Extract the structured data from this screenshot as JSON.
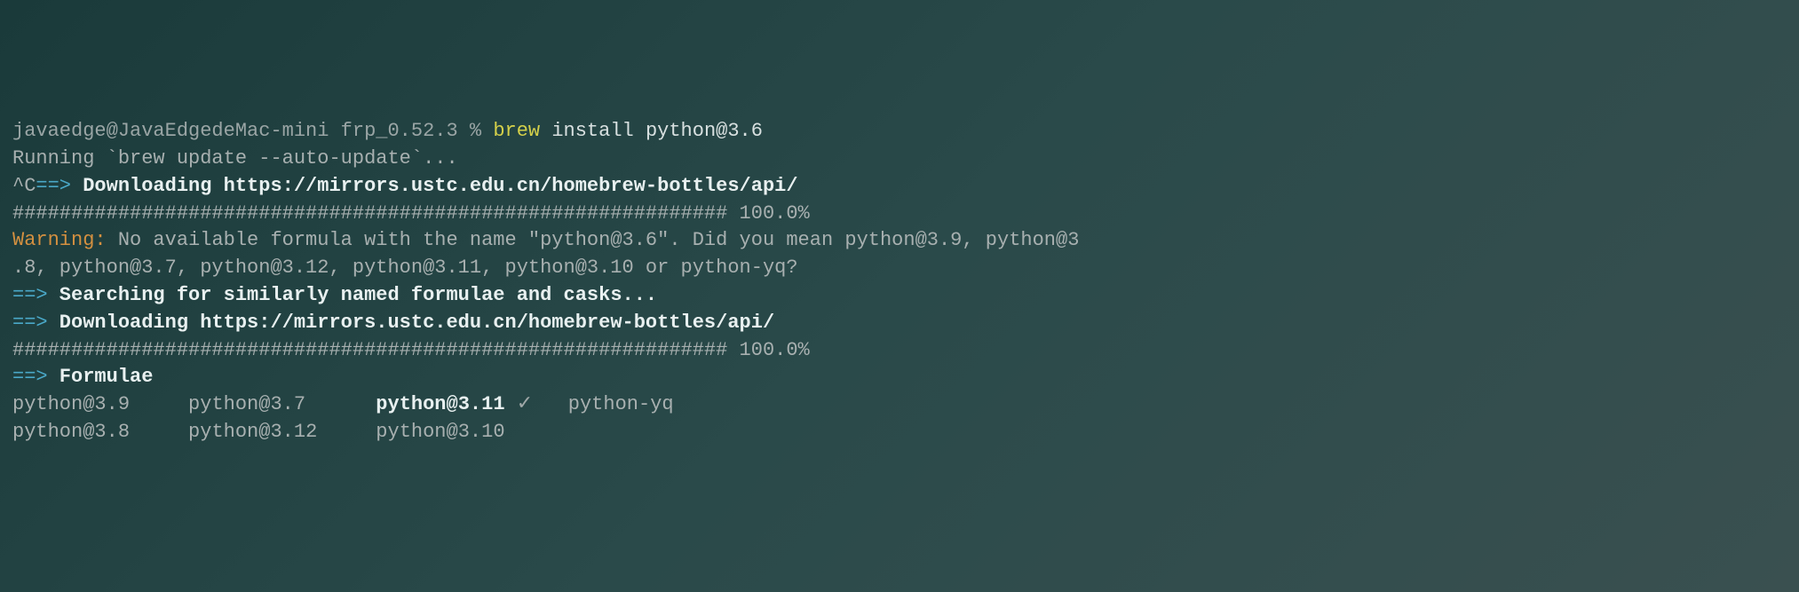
{
  "prompt": {
    "user_host": "javaedge@JavaEdgedeMac-mini",
    "dir": "frp_0.52.3",
    "sep": "%",
    "cmd_brew": "brew",
    "cmd_rest": " install python@3.6"
  },
  "lines": {
    "running": "Running `brew update --auto-update`...",
    "ctrl_c": "^C",
    "arrow": "==>",
    "downloading": " Downloading https://mirrors.ustc.edu.cn/homebrew-bottles/api/",
    "progress": "############################################################# 100.0%",
    "warning_label": "Warning:",
    "warning_text1": " No available formula with the name \"python@3.6\". Did you mean python@3.9, python@3",
    "warning_text2": ".8, python@3.7, python@3.12, python@3.11, python@3.10 or python-yq?",
    "searching": " Searching for similarly named formulae and casks...",
    "formulae": " Formulae"
  },
  "formulae_row1": {
    "c1": "python@3.9",
    "c2": "python@3.7",
    "c3": "python@3.11",
    "check": " ✓",
    "c4": "python-yq"
  },
  "formulae_row2": {
    "c1": "python@3.8",
    "c2": "python@3.12",
    "c3": "python@3.10"
  }
}
